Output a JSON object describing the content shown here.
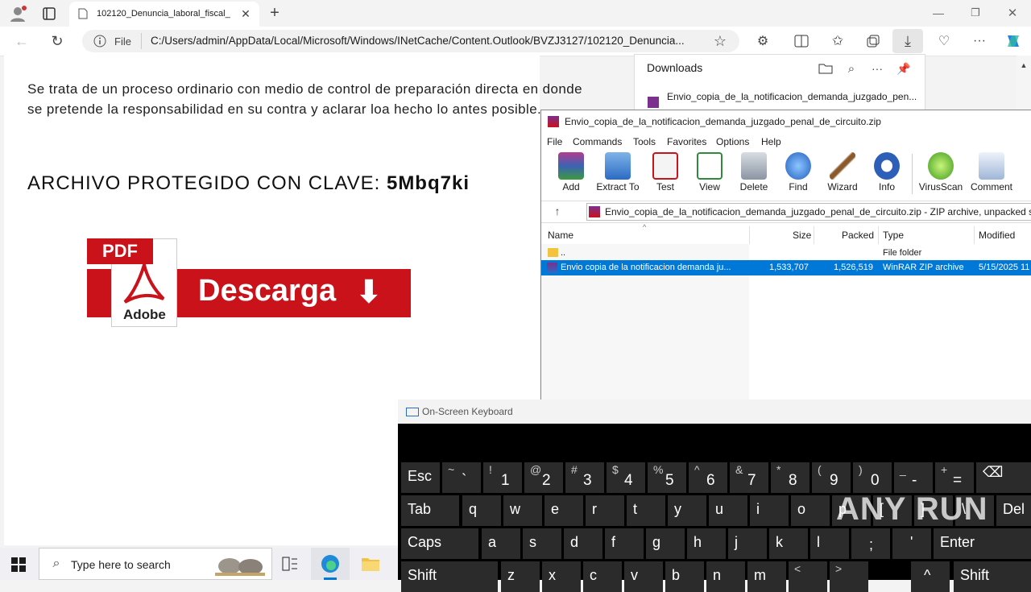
{
  "browser": {
    "tab_title": "102120_Denuncia_laboral_fiscal_",
    "url_scheme": "File",
    "url": "C:/Users/admin/AppData/Local/Microsoft/Windows/INetCache/Content.Outlook/BVZJ3127/102120_Denuncia..."
  },
  "page": {
    "paragraph": "Se trata de un proceso ordinario con medio de control de preparación directa en donde se pretende la responsabilidad en su contra y aclarar loa hecho lo antes posible.",
    "key_label": "ARCHIVO PROTEGIDO CON CLAVE:",
    "key_value": "5Mbq7ki",
    "banner_pdf": "PDF",
    "banner_adobe": "Adobe",
    "banner_text": "Descarga",
    "banner_arrow": "⬇"
  },
  "downloads": {
    "title": "Downloads",
    "item_name": "Envio_copia_de_la_notificacion_demanda_juzgado_pen..."
  },
  "winrar": {
    "title": "Envio_copia_de_la_notificacion_demanda_juzgado_penal_de_circuito.zip",
    "menu": [
      "File",
      "Commands",
      "Tools",
      "Favorites",
      "Options",
      "Help"
    ],
    "tools": [
      "Add",
      "Extract To",
      "Test",
      "View",
      "Delete",
      "Find",
      "Wizard",
      "Info",
      "VirusScan",
      "Comment"
    ],
    "path": "Envio_copia_de_la_notificacion_demanda_juzgado_penal_de_circuito.zip - ZIP archive, unpacked size",
    "columns": [
      "Name",
      "Size",
      "Packed",
      "Type",
      "Modified"
    ],
    "rows": [
      {
        "name": "..",
        "size": "",
        "packed": "",
        "type": "File folder",
        "modified": ""
      },
      {
        "name": "Envio copia de la notificacion demanda ju...",
        "size": "1,533,707",
        "packed": "1,526,519",
        "type": "WinRAR ZIP archive",
        "modified": "5/15/2025 11"
      }
    ]
  },
  "osk": {
    "title": "On-Screen Keyboard",
    "row1": [
      {
        "m": "Esc",
        "s": ""
      },
      {
        "m": "`",
        "s": "~"
      },
      {
        "m": "1",
        "s": "!"
      },
      {
        "m": "2",
        "s": "@"
      },
      {
        "m": "3",
        "s": "#"
      },
      {
        "m": "4",
        "s": "$"
      },
      {
        "m": "5",
        "s": "%"
      },
      {
        "m": "6",
        "s": "^"
      },
      {
        "m": "7",
        "s": "&"
      },
      {
        "m": "8",
        "s": "*"
      },
      {
        "m": "9",
        "s": "("
      },
      {
        "m": "0",
        "s": ")"
      },
      {
        "m": "-",
        "s": "_"
      },
      {
        "m": "=",
        "s": "+"
      },
      {
        "m": "⌫",
        "s": ""
      }
    ],
    "row2": [
      "Tab",
      "q",
      "w",
      "e",
      "r",
      "t",
      "y",
      "u",
      "i",
      "o",
      "p",
      "[",
      "]",
      "\\",
      "Del"
    ],
    "row3": [
      "Caps",
      "a",
      "s",
      "d",
      "f",
      "g",
      "h",
      "j",
      "k",
      "l",
      ";",
      "'",
      "Enter"
    ],
    "row4": [
      "Shift",
      "z",
      "x",
      "c",
      "v",
      "b",
      "n",
      "m",
      "<",
      ">",
      "^",
      "Shift"
    ]
  },
  "taskbar": {
    "search_placeholder": "Type here to search"
  },
  "watermark": "ANY RUN"
}
